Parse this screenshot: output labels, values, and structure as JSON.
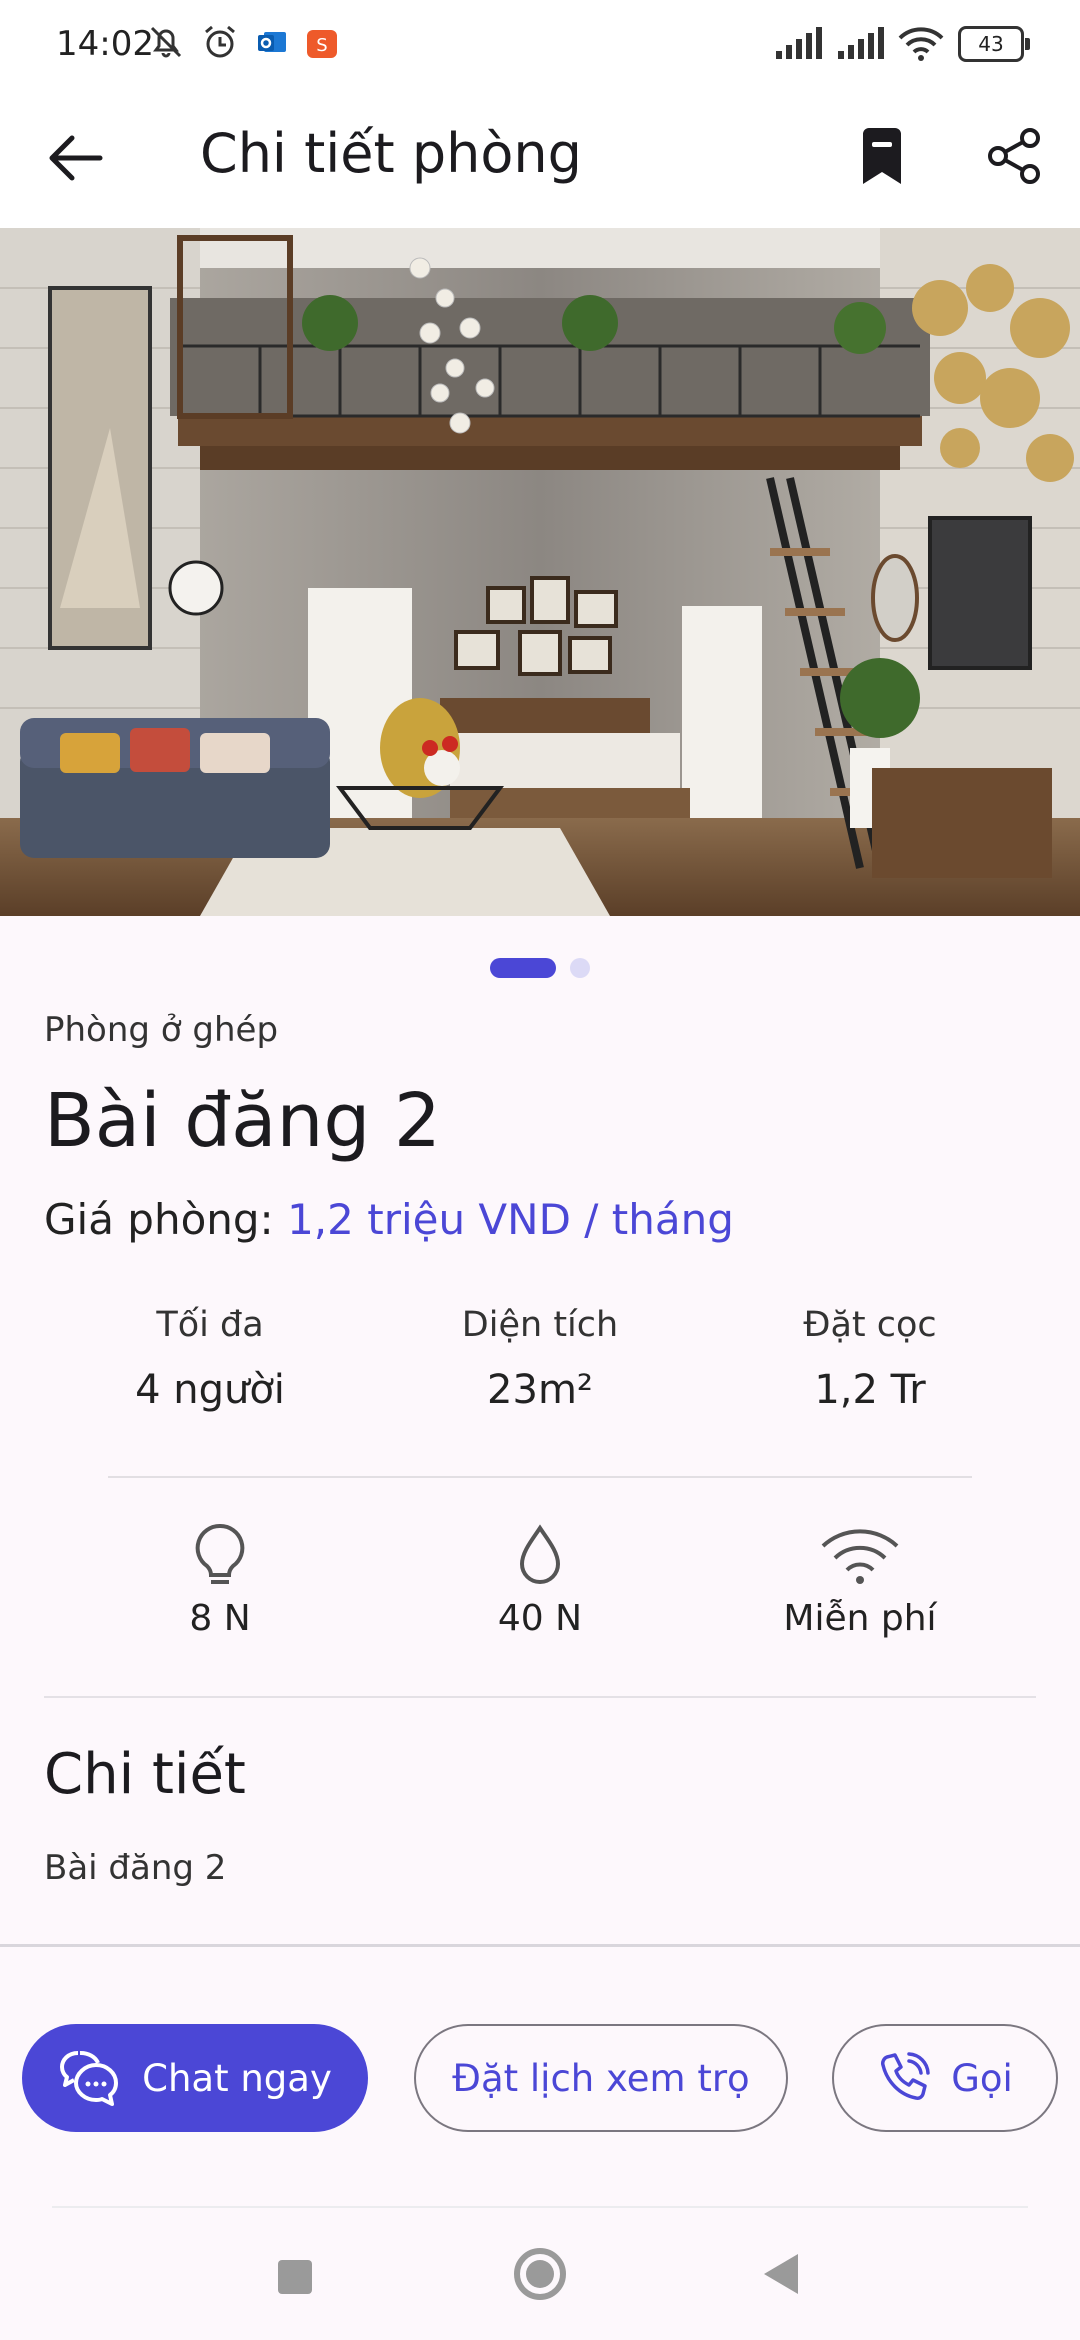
{
  "status_bar": {
    "time": "14:02",
    "battery": "43",
    "icons": [
      "muted-bell-icon",
      "alarm-icon",
      "outlook-icon",
      "shopee-icon",
      "signal-icon",
      "signal-icon",
      "wifi-icon"
    ]
  },
  "app_bar": {
    "title": "Chi tiết phòng",
    "icons": [
      "back-arrow-icon",
      "bookmark-icon",
      "share-icon"
    ]
  },
  "gallery": {
    "page_count": 2,
    "current_page": 1
  },
  "listing": {
    "room_type": "Phòng ở ghép",
    "title": "Bài đăng 2",
    "price_label": "Giá phòng:",
    "price_value": "1,2 triệu VND / tháng"
  },
  "stats": [
    {
      "label": "Tối đa",
      "value": "4 người"
    },
    {
      "label": "Diện tích",
      "value": "23m²"
    },
    {
      "label": "Đặt cọc",
      "value": "1,2 Tr"
    }
  ],
  "utilities": [
    {
      "icon": "lightbulb-icon",
      "value": "8 N"
    },
    {
      "icon": "water-drop-icon",
      "value": "40 N"
    },
    {
      "icon": "wifi-icon",
      "value": "Miễn phí"
    }
  ],
  "details": {
    "heading": "Chi tiết",
    "body": "Bài đăng 2"
  },
  "actions": {
    "chat_label": "Chat ngay",
    "schedule_label": "Đặt lịch xem trọ",
    "call_label": "Gọi"
  },
  "colors": {
    "accent": "#4b47d6",
    "background": "#fdf8fc"
  }
}
